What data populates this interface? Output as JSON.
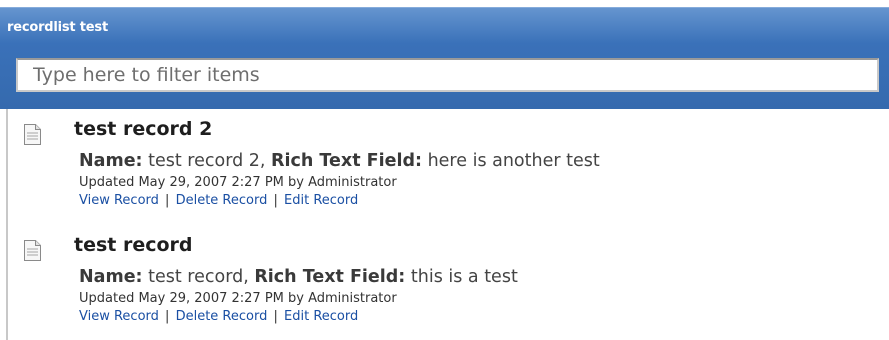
{
  "panel": {
    "title": "recordlist test",
    "corner_mark": "ˇ"
  },
  "filter": {
    "placeholder": "Type here to filter items",
    "value": ""
  },
  "records": [
    {
      "title": "test record 2",
      "name_label": "Name:",
      "name_value": " test record 2, ",
      "rich_label": "Rich Text Field:",
      "rich_value": " here is another test",
      "updated": "Updated May 29, 2007 2:27 PM by Administrator",
      "actions": {
        "view": "View Record",
        "delete": "Delete Record",
        "edit": "Edit Record",
        "separator": "|"
      },
      "icon": "document-icon"
    },
    {
      "title": "test record",
      "name_label": "Name:",
      "name_value": " test record, ",
      "rich_label": "Rich Text Field:",
      "rich_value": " this is a test",
      "updated": "Updated May 29, 2007 2:27 PM by Administrator",
      "actions": {
        "view": "View Record",
        "delete": "Delete Record",
        "edit": "Edit Record",
        "separator": "|"
      },
      "icon": "document-icon"
    }
  ],
  "colors": {
    "header_top": "#6595cf",
    "header_bottom": "#356aae",
    "link": "#1a4fa3"
  }
}
